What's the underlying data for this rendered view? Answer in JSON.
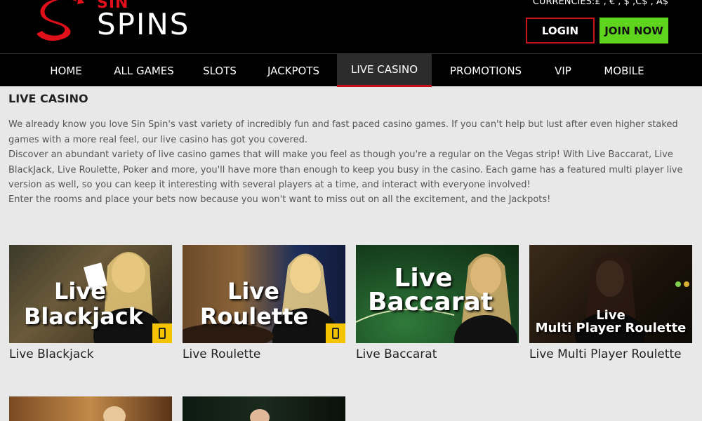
{
  "header": {
    "logo_small": "SIN",
    "logo_large": "SPINS",
    "currencies": "CURRENCIES:£ , € , $ ,C$ , A$",
    "login_label": "LOGIN",
    "join_label": "JOIN NOW"
  },
  "nav": {
    "items": [
      {
        "label": "HOME"
      },
      {
        "label": "ALL GAMES"
      },
      {
        "label": "SLOTS"
      },
      {
        "label": "JACKPOTS"
      },
      {
        "label": "LIVE CASINO"
      },
      {
        "label": "PROMOTIONS"
      },
      {
        "label": "VIP"
      },
      {
        "label": "MOBILE"
      }
    ],
    "active": "LIVE CASINO"
  },
  "main": {
    "title": "LIVE CASINO",
    "paragraphs": [
      "We already know you love Sin Spin's vast variety of incredibly fun and fast paced casino games. If you can't help but lust after even higher staked games with a more real feel, our live casino has got you covered.",
      "Discover an abundant variety of live casino games that will make you feel as though you're a regular on the Vegas strip! With Live Baccarat, Live BlackJack, Live Roulette, Poker and more, you'll have more than enough to keep you busy in the casino. Each game has a featured multi player live version as well, so you can keep it interesting with several players at a time, and interact with everyone involved!",
      "Enter the rooms and place your bets now because you won't want to miss out on all the excitement, and the Jackpots!"
    ]
  },
  "games": [
    {
      "label": "Live Blackjack",
      "overlay_top": "Live",
      "overlay_bottom": "Blackjack",
      "mobile": true
    },
    {
      "label": "Live Roulette",
      "overlay_top": "Live",
      "overlay_bottom": "Roulette",
      "mobile": true
    },
    {
      "label": "Live Baccarat",
      "overlay_top": "Live",
      "overlay_bottom": "Baccarat",
      "mobile": false
    },
    {
      "label": "Live Multi Player Roulette",
      "overlay_top": "Live",
      "overlay_bottom": "Multi Player Roulette",
      "mobile": false
    }
  ],
  "colors": {
    "brand_red": "#c8101b",
    "join_green": "#5ed51c",
    "mobile_badge": "#f5c400"
  }
}
